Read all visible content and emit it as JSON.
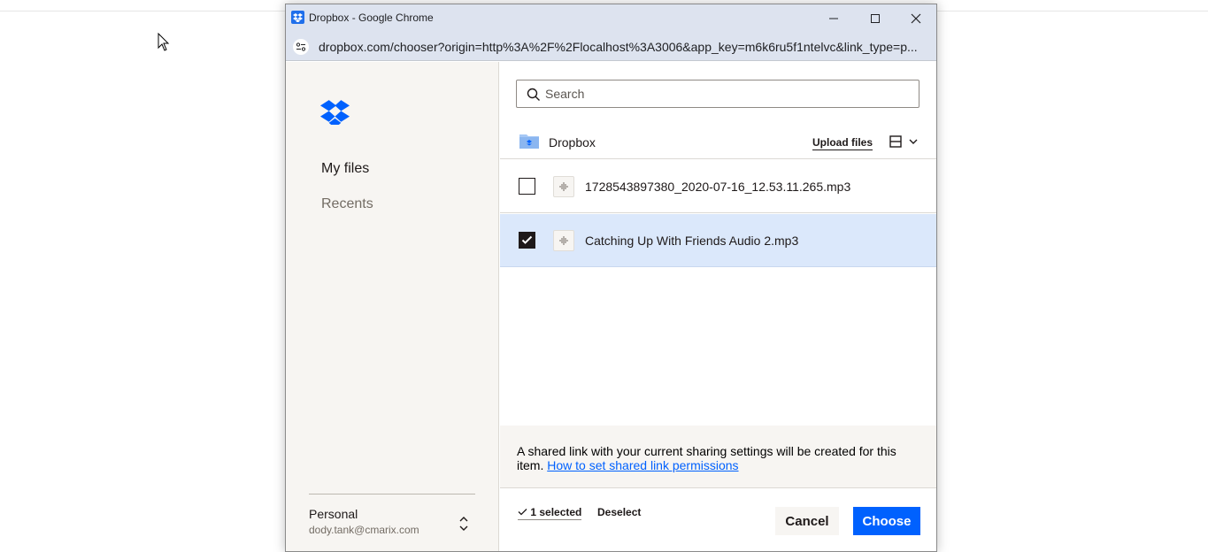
{
  "window": {
    "title": "Dropbox - Google Chrome",
    "url": "dropbox.com/chooser?origin=http%3A%2F%2Flocalhost%3A3006&app_key=m6k6ru5f1ntelvc&link_type=p..."
  },
  "sidebar": {
    "items": [
      {
        "label": "My files",
        "active": true
      },
      {
        "label": "Recents",
        "active": false
      }
    ],
    "account": {
      "name": "Personal",
      "email": "dody.tank@cmarix.com"
    }
  },
  "search": {
    "placeholder": "Search"
  },
  "breadcrumb": {
    "folder": "Dropbox"
  },
  "toolbar": {
    "upload_label": "Upload files"
  },
  "files": [
    {
      "name": "1728543897380_2020-07-16_12.53.11.265.mp3",
      "selected": false
    },
    {
      "name": "Catching Up With Friends Audio 2.mp3",
      "selected": true
    }
  ],
  "notice": {
    "text": "A shared link with your current sharing settings will be created for this item.",
    "link": "How to set shared link permissions"
  },
  "footer": {
    "selected_count": "1 selected",
    "deselect_label": "Deselect",
    "cancel_label": "Cancel",
    "choose_label": "Choose"
  },
  "colors": {
    "accent": "#0061fe",
    "selected_row": "#dbe8fb",
    "sidebar_bg": "#f7f5f2"
  }
}
